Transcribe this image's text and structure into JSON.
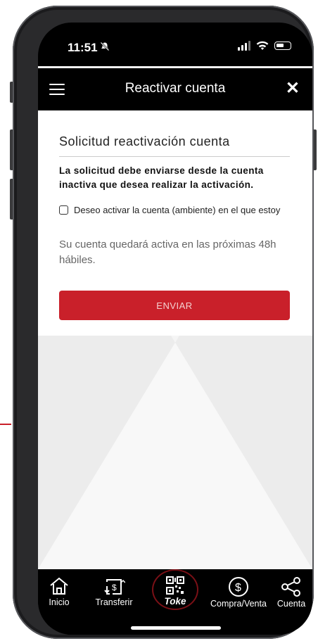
{
  "status_bar": {
    "time": "11:51"
  },
  "header": {
    "title": "Reactivar cuenta"
  },
  "form": {
    "title": "Solicitud reactivación cuenta",
    "instruction": "La solicitud debe enviarse desde la cuenta inactiva que desea realizar la activación.",
    "checkbox_label": "Deseo activar la cuenta (ambiente) en el que estoy",
    "checkbox_checked": false,
    "note": "Su cuenta quedará activa en las próximas 48h hábiles.",
    "submit_label": "ENVIAR"
  },
  "tabbar": {
    "items": [
      {
        "label": "Inicio",
        "icon": "home-icon"
      },
      {
        "label": "Transferir",
        "icon": "transfer-icon"
      },
      {
        "label": "Toke",
        "icon": "qr-icon"
      },
      {
        "label": "Compra/Venta",
        "icon": "dollar-icon"
      },
      {
        "label": "Cuenta",
        "icon": "share-icon"
      }
    ]
  },
  "colors": {
    "accent": "#c9202a",
    "header": "#000000",
    "background": "#f5f5f5"
  }
}
